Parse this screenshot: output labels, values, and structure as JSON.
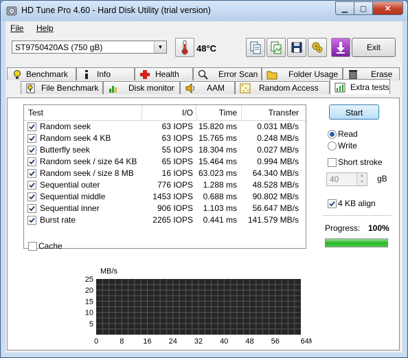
{
  "window": {
    "title": "HD Tune Pro 4.60 - Hard Disk Utility (trial version)"
  },
  "menu": {
    "file": "File",
    "help": "Help"
  },
  "toolbar": {
    "drive": "ST9750420AS (750 gB)",
    "temperature": "48°C",
    "exit_label": "Exit"
  },
  "tabs_top": [
    "Benchmark",
    "Info",
    "Health",
    "Error Scan",
    "Folder Usage",
    "Erase"
  ],
  "tabs_bottom": [
    "File Benchmark",
    "Disk monitor",
    "AAM",
    "Random Access",
    "Extra tests"
  ],
  "table": {
    "headers": {
      "test": "Test",
      "io": "I/O",
      "time": "Time",
      "transfer": "Transfer"
    },
    "rows": [
      {
        "test": "Random seek",
        "io": "63 IOPS",
        "time": "15.820 ms",
        "transfer": "0.031 MB/s",
        "checked": true
      },
      {
        "test": "Random seek 4 KB",
        "io": "63 IOPS",
        "time": "15.765 ms",
        "transfer": "0.248 MB/s",
        "checked": true
      },
      {
        "test": "Butterfly seek",
        "io": "55 IOPS",
        "time": "18.304 ms",
        "transfer": "0.027 MB/s",
        "checked": true
      },
      {
        "test": "Random seek / size 64 KB",
        "io": "65 IOPS",
        "time": "15.464 ms",
        "transfer": "0.994 MB/s",
        "checked": true
      },
      {
        "test": "Random seek / size 8 MB",
        "io": "16 IOPS",
        "time": "63.023 ms",
        "transfer": "64.340 MB/s",
        "checked": true
      },
      {
        "test": "Sequential outer",
        "io": "776 IOPS",
        "time": "1.288 ms",
        "transfer": "48.528 MB/s",
        "checked": true
      },
      {
        "test": "Sequential middle",
        "io": "1453 IOPS",
        "time": "0.688 ms",
        "transfer": "90.802 MB/s",
        "checked": true
      },
      {
        "test": "Sequential inner",
        "io": "906 IOPS",
        "time": "1.103 ms",
        "transfer": "56.647 MB/s",
        "checked": true
      },
      {
        "test": "Burst rate",
        "io": "2265 IOPS",
        "time": "0.441 ms",
        "transfer": "141.579 MB/s",
        "checked": true
      }
    ]
  },
  "controls": {
    "start_label": "Start",
    "read_label": "Read",
    "write_label": "Write",
    "mode_selected": "Read",
    "short_stroke_label": "Short stroke",
    "short_stroke_checked": false,
    "stroke_value": "40",
    "stroke_unit": "gB",
    "align_label": "4 KB align",
    "align_checked": true,
    "progress_label": "Progress:",
    "progress_value": "100%",
    "progress_fraction": 1.0,
    "cache_label": "Cache",
    "cache_checked": false
  },
  "chart_data": {
    "type": "line",
    "ylabel": "MB/s",
    "ylim": [
      0,
      25
    ],
    "yticks": [
      "25",
      "20",
      "15",
      "10",
      "5"
    ],
    "xticks": [
      "0",
      "8",
      "16",
      "24",
      "32",
      "40",
      "48",
      "56",
      "64MB"
    ],
    "series": []
  },
  "colors": {
    "chart_bg": "#262626",
    "chart_grid": "#575757",
    "progress_fill": "#27b527",
    "accent": "#3c7fb1"
  }
}
